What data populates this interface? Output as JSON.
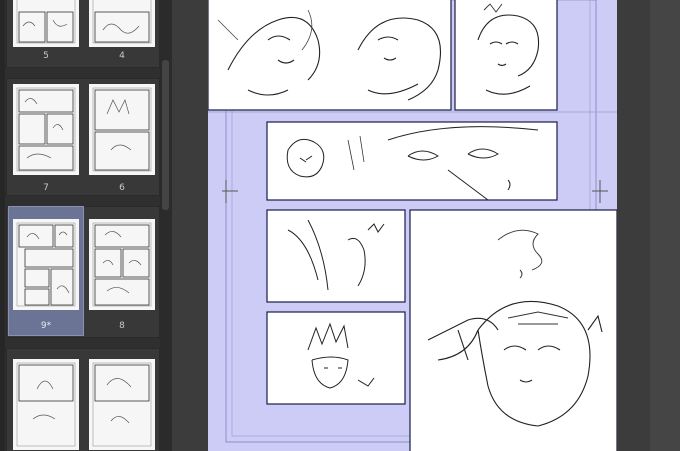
{
  "pages_panel": {
    "rows": [
      {
        "left": {
          "number": "5"
        },
        "right": {
          "number": "4"
        }
      },
      {
        "left": {
          "number": "7"
        },
        "right": {
          "number": "6"
        }
      },
      {
        "left": {
          "number": "9*"
        },
        "right": {
          "number": "8"
        }
      },
      {
        "left": {
          "number": ""
        },
        "right": {
          "number": ""
        }
      }
    ],
    "selected_page": "9*"
  },
  "canvas": {
    "page_fill_color": "#ccccf6",
    "panel_border_color": "#1b1b4a"
  },
  "colors": {
    "panel_bg": "#2f2f2f",
    "selected_thumb": "#6b7494",
    "workspace_bg": "#3c3c3c"
  }
}
